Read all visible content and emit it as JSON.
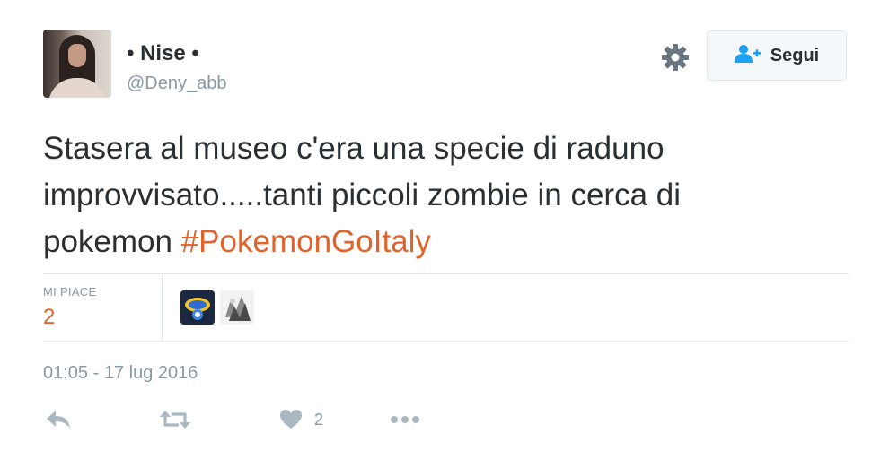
{
  "tweet": {
    "author": {
      "display_name": "• Nise •",
      "handle": "@Deny_abb"
    },
    "follow_label": "Segui",
    "text_lines": [
      "Stasera al museo c'era una specie di raduno",
      "improvvisato.....tanti piccoli zombie in cerca di",
      "pokemon "
    ],
    "hashtag": "#PokemonGoItaly",
    "likes": {
      "label": "MI PIACE",
      "count": "2"
    },
    "timestamp": "01:05 - 17 lug 2016",
    "actions": {
      "like_count": "2"
    }
  },
  "colors": {
    "accent": "#e2622a",
    "text": "#292f33",
    "muted": "#8899a6",
    "border": "#e1e8ed"
  },
  "icons": [
    "gear-icon",
    "follow-person-icon",
    "reply-icon",
    "retweet-icon",
    "heart-icon",
    "more-icon"
  ]
}
